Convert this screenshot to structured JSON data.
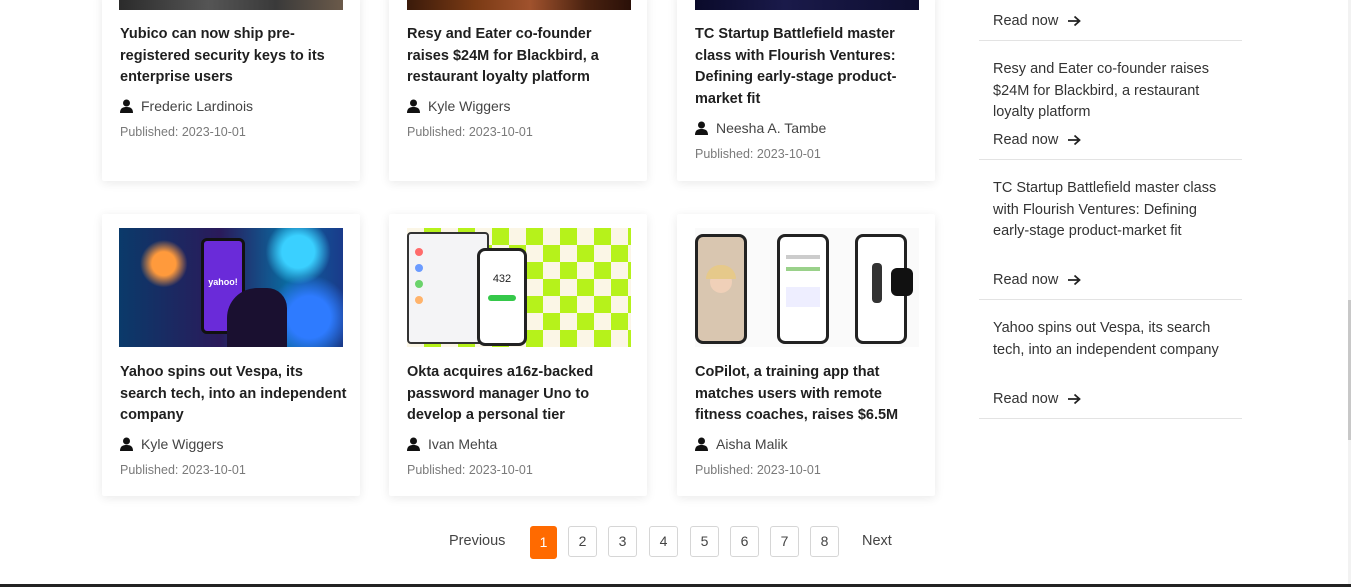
{
  "cards": [
    {
      "title": "Yubico can now ship pre-registered security keys to its enterprise users",
      "author": "Frederic Lardinois",
      "published": "Published: 2023-10-01"
    },
    {
      "title": "Resy and Eater co-founder raises $24M for Blackbird, a restaurant loyalty platform",
      "author": "Kyle Wiggers",
      "published": "Published: 2023-10-01"
    },
    {
      "title": "TC Startup Battlefield master class with Flourish Ventures: Defining early-stage product-market fit",
      "author": "Neesha A. Tambe",
      "published": "Published: 2023-10-01"
    },
    {
      "title": "Yahoo spins out Vespa, its search tech, into an independent company",
      "author": "Kyle Wiggers",
      "published": "Published: 2023-10-01",
      "image_text": "yahoo!"
    },
    {
      "title": "Okta acquires a16z-backed password manager Uno to develop a personal tier",
      "author": "Ivan Mehta",
      "published": "Published: 2023-10-01",
      "image_text": "432"
    },
    {
      "title": "CoPilot, a training app that matches users with remote fitness coaches, raises $6.5M",
      "author": "Aisha Malik",
      "published": "Published: 2023-10-01"
    }
  ],
  "sidebar": {
    "read_now_label": "Read now",
    "items": [
      {
        "title": ""
      },
      {
        "title": "Resy and Eater co-founder raises $24M for Blackbird, a restaurant loyalty platform"
      },
      {
        "title": "TC Startup Battlefield master class with Flourish Ventures: Defining early-stage product-market fit"
      },
      {
        "title": "Yahoo spins out Vespa, its search tech, into an independent company"
      }
    ]
  },
  "pagination": {
    "previous": "Previous",
    "next": "Next",
    "pages": [
      "1",
      "2",
      "3",
      "4",
      "5",
      "6",
      "7",
      "8"
    ],
    "current": "1"
  },
  "colors": {
    "accent": "#ff6a00",
    "text": "#1f1f1f",
    "muted": "#7a7a7a"
  },
  "icons": {
    "author": "user-icon",
    "read_now": "arrow-right-icon"
  }
}
